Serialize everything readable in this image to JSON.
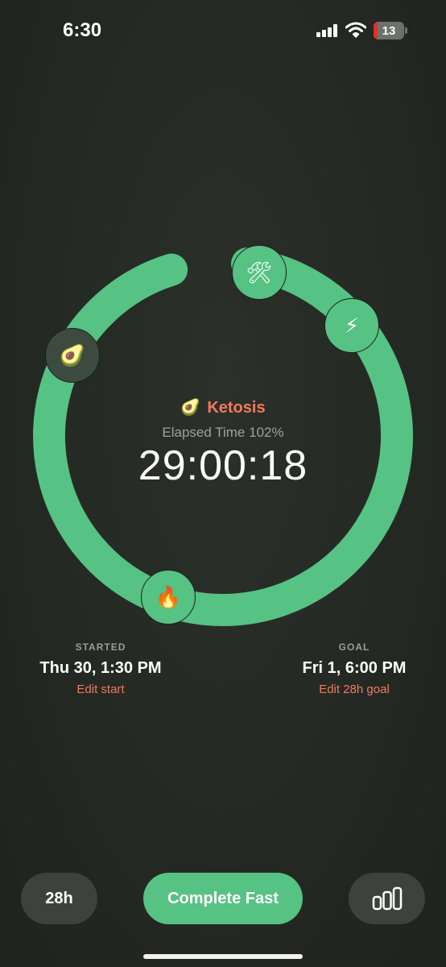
{
  "status_bar": {
    "time": "6:30",
    "battery_level": "13",
    "battery_fraction": 0.13,
    "signal_icon": "cellular-signal-icon",
    "wifi_icon": "wifi-icon"
  },
  "ring": {
    "progress_fraction": 0.93,
    "color": "#56c283",
    "milestones": [
      {
        "name": "hammer-wrench-icon",
        "glyph": "🛠"
      },
      {
        "name": "lightning-icon",
        "glyph": "⚡"
      },
      {
        "name": "fire-icon",
        "glyph": "🔥"
      },
      {
        "name": "avocado-icon",
        "glyph": "🥑"
      }
    ]
  },
  "phase": {
    "emoji": "🥑",
    "label": "Ketosis",
    "color": "#ef7a5f"
  },
  "elapsed": {
    "label": "Elapsed Time 102%",
    "timer": "29:00:18"
  },
  "started": {
    "label": "STARTED",
    "value": "Thu 30, 1:30 PM",
    "edit_label": "Edit start"
  },
  "goal": {
    "label": "GOAL",
    "value": "Fri 1, 6:00 PM",
    "edit_label": "Edit 28h goal"
  },
  "bottom_bar": {
    "duration_label": "28h",
    "complete_label": "Complete Fast",
    "stats_icon": "bar-chart-icon"
  }
}
